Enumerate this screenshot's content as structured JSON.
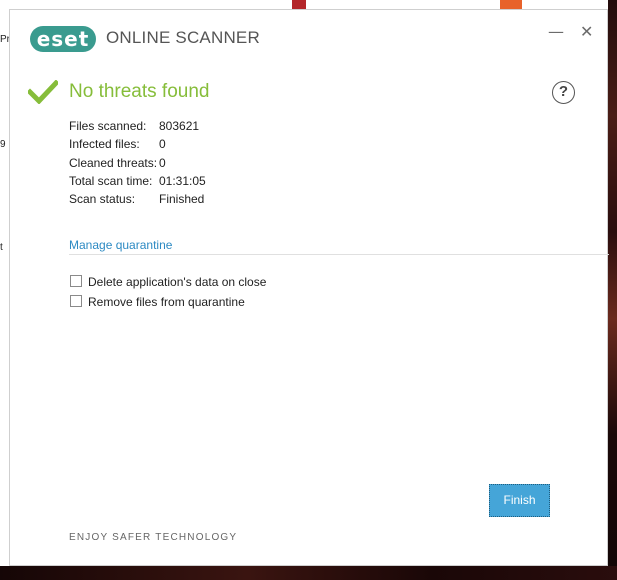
{
  "desktop": {
    "left_fragments": [
      "Pr",
      "9",
      "t"
    ]
  },
  "window": {
    "brand": "eset",
    "app_title": "ONLINE SCANNER",
    "minimize_label": "—",
    "close_label": "✕"
  },
  "result": {
    "title": "No threats found",
    "help_label": "?",
    "accent_color": "#86bd3a"
  },
  "stats": [
    {
      "label": "Files scanned:",
      "value": "803621"
    },
    {
      "label": "Infected files:",
      "value": "0"
    },
    {
      "label": "Cleaned threats:",
      "value": "0"
    },
    {
      "label": "Total scan time:",
      "value": "01:31:05"
    },
    {
      "label": "Scan status:",
      "value": "Finished"
    }
  ],
  "links": {
    "manage_quarantine": "Manage quarantine"
  },
  "options": [
    {
      "label": "Delete application's data on close",
      "checked": false
    },
    {
      "label": "Remove files from quarantine",
      "checked": false
    }
  ],
  "buttons": {
    "finish": "Finish"
  },
  "footer": {
    "tagline": "ENJOY SAFER TECHNOLOGY"
  },
  "colors": {
    "brand": "#3a9b8f",
    "link": "#2d8ac3",
    "button": "#45a5d8"
  }
}
